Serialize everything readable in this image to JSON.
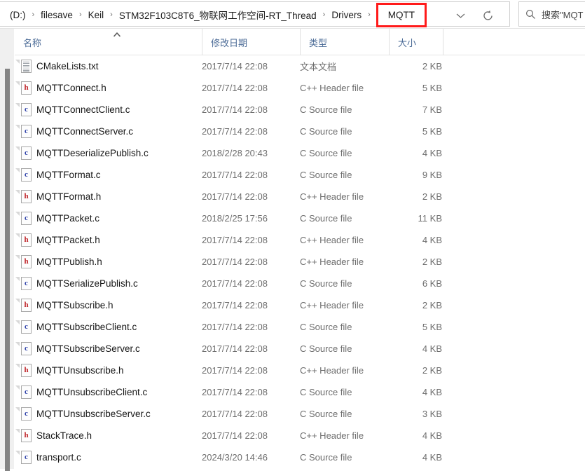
{
  "addressbar": {
    "breadcrumbs": [
      {
        "label": "(D:)",
        "highlighted": false
      },
      {
        "label": "filesave",
        "highlighted": false
      },
      {
        "label": "Keil",
        "highlighted": false
      },
      {
        "label": "STM32F103C8T6_物联网工作空间-RT_Thread",
        "highlighted": false
      },
      {
        "label": "Drivers",
        "highlighted": false
      },
      {
        "label": "MQTT",
        "highlighted": true
      }
    ],
    "separator": "›",
    "dropdown_icon": "chevron-down-icon",
    "refresh_icon": "refresh-icon",
    "highlight_color": "#ff1a1a"
  },
  "search": {
    "icon": "search-icon",
    "placeholder": "搜索\"MQT",
    "value": ""
  },
  "columns": {
    "name": "名称",
    "date_modified": "修改日期",
    "type": "类型",
    "size": "大小",
    "sort_indicator": "caret-up-icon",
    "sorted_by": "名称"
  },
  "files": [
    {
      "icon": "txt-file-icon",
      "kind": "txt",
      "name": "CMakeLists.txt",
      "date": "2017/7/14 22:08",
      "type": "文本文档",
      "size": "2 KB"
    },
    {
      "icon": "h-file-icon",
      "kind": "h",
      "name": "MQTTConnect.h",
      "date": "2017/7/14 22:08",
      "type": "C++ Header file",
      "size": "5 KB"
    },
    {
      "icon": "c-file-icon",
      "kind": "c",
      "name": "MQTTConnectClient.c",
      "date": "2017/7/14 22:08",
      "type": "C Source file",
      "size": "7 KB"
    },
    {
      "icon": "c-file-icon",
      "kind": "c",
      "name": "MQTTConnectServer.c",
      "date": "2017/7/14 22:08",
      "type": "C Source file",
      "size": "5 KB"
    },
    {
      "icon": "c-file-icon",
      "kind": "c",
      "name": "MQTTDeserializePublish.c",
      "date": "2018/2/28 20:43",
      "type": "C Source file",
      "size": "4 KB"
    },
    {
      "icon": "c-file-icon",
      "kind": "c",
      "name": "MQTTFormat.c",
      "date": "2017/7/14 22:08",
      "type": "C Source file",
      "size": "9 KB"
    },
    {
      "icon": "h-file-icon",
      "kind": "h",
      "name": "MQTTFormat.h",
      "date": "2017/7/14 22:08",
      "type": "C++ Header file",
      "size": "2 KB"
    },
    {
      "icon": "c-file-icon",
      "kind": "c",
      "name": "MQTTPacket.c",
      "date": "2018/2/25 17:56",
      "type": "C Source file",
      "size": "11 KB"
    },
    {
      "icon": "h-file-icon",
      "kind": "h",
      "name": "MQTTPacket.h",
      "date": "2017/7/14 22:08",
      "type": "C++ Header file",
      "size": "4 KB"
    },
    {
      "icon": "h-file-icon",
      "kind": "h",
      "name": "MQTTPublish.h",
      "date": "2017/7/14 22:08",
      "type": "C++ Header file",
      "size": "2 KB"
    },
    {
      "icon": "c-file-icon",
      "kind": "c",
      "name": "MQTTSerializePublish.c",
      "date": "2017/7/14 22:08",
      "type": "C Source file",
      "size": "6 KB"
    },
    {
      "icon": "h-file-icon",
      "kind": "h",
      "name": "MQTTSubscribe.h",
      "date": "2017/7/14 22:08",
      "type": "C++ Header file",
      "size": "2 KB"
    },
    {
      "icon": "c-file-icon",
      "kind": "c",
      "name": "MQTTSubscribeClient.c",
      "date": "2017/7/14 22:08",
      "type": "C Source file",
      "size": "5 KB"
    },
    {
      "icon": "c-file-icon",
      "kind": "c",
      "name": "MQTTSubscribeServer.c",
      "date": "2017/7/14 22:08",
      "type": "C Source file",
      "size": "4 KB"
    },
    {
      "icon": "h-file-icon",
      "kind": "h",
      "name": "MQTTUnsubscribe.h",
      "date": "2017/7/14 22:08",
      "type": "C++ Header file",
      "size": "2 KB"
    },
    {
      "icon": "c-file-icon",
      "kind": "c",
      "name": "MQTTUnsubscribeClient.c",
      "date": "2017/7/14 22:08",
      "type": "C Source file",
      "size": "4 KB"
    },
    {
      "icon": "c-file-icon",
      "kind": "c",
      "name": "MQTTUnsubscribeServer.c",
      "date": "2017/7/14 22:08",
      "type": "C Source file",
      "size": "3 KB"
    },
    {
      "icon": "h-file-icon",
      "kind": "h",
      "name": "StackTrace.h",
      "date": "2017/7/14 22:08",
      "type": "C++ Header file",
      "size": "4 KB"
    },
    {
      "icon": "c-file-icon",
      "kind": "c",
      "name": "transport.c",
      "date": "2024/3/20 14:46",
      "type": "C Source file",
      "size": "4 KB"
    }
  ]
}
